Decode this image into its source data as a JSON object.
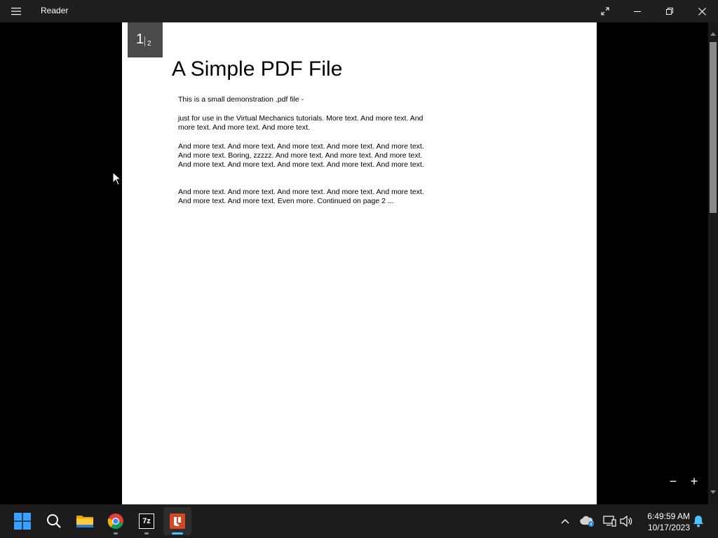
{
  "window": {
    "title": "Reader"
  },
  "document": {
    "current_page": "1",
    "total_pages": "2",
    "title": "A Simple PDF File",
    "paragraphs": [
      "This is a small demonstration .pdf file -",
      "just for use in the Virtual Mechanics tutorials. More text. And more text. And more text. And more text. And more text.",
      "And more text. And more text. And more text. And more text. And more text. And more text. Boring, zzzzz. And more text. And more text. And more text. And more text. And more text. And more text. And more text. And more text.",
      "And more text. And more text. And more text. And more text. And more text. And more text. And more text. Even more. Continued on page 2 ..."
    ]
  },
  "zoom": {
    "out_label": "−",
    "in_label": "+"
  },
  "taskbar": {
    "apps": [
      "start-icon",
      "search-icon",
      "file-explorer-icon",
      "chrome-icon",
      "7zip-icon",
      "reader-icon"
    ],
    "seven_zip_label": "7z"
  },
  "clock": {
    "time": "6:49:59 AM",
    "date": "10/17/2023"
  },
  "colors": {
    "titlebar": "#1f1f1f",
    "taskbar": "#1c1c1c",
    "active_indicator": "#4cc2ff",
    "reader_red": "#d24726"
  }
}
